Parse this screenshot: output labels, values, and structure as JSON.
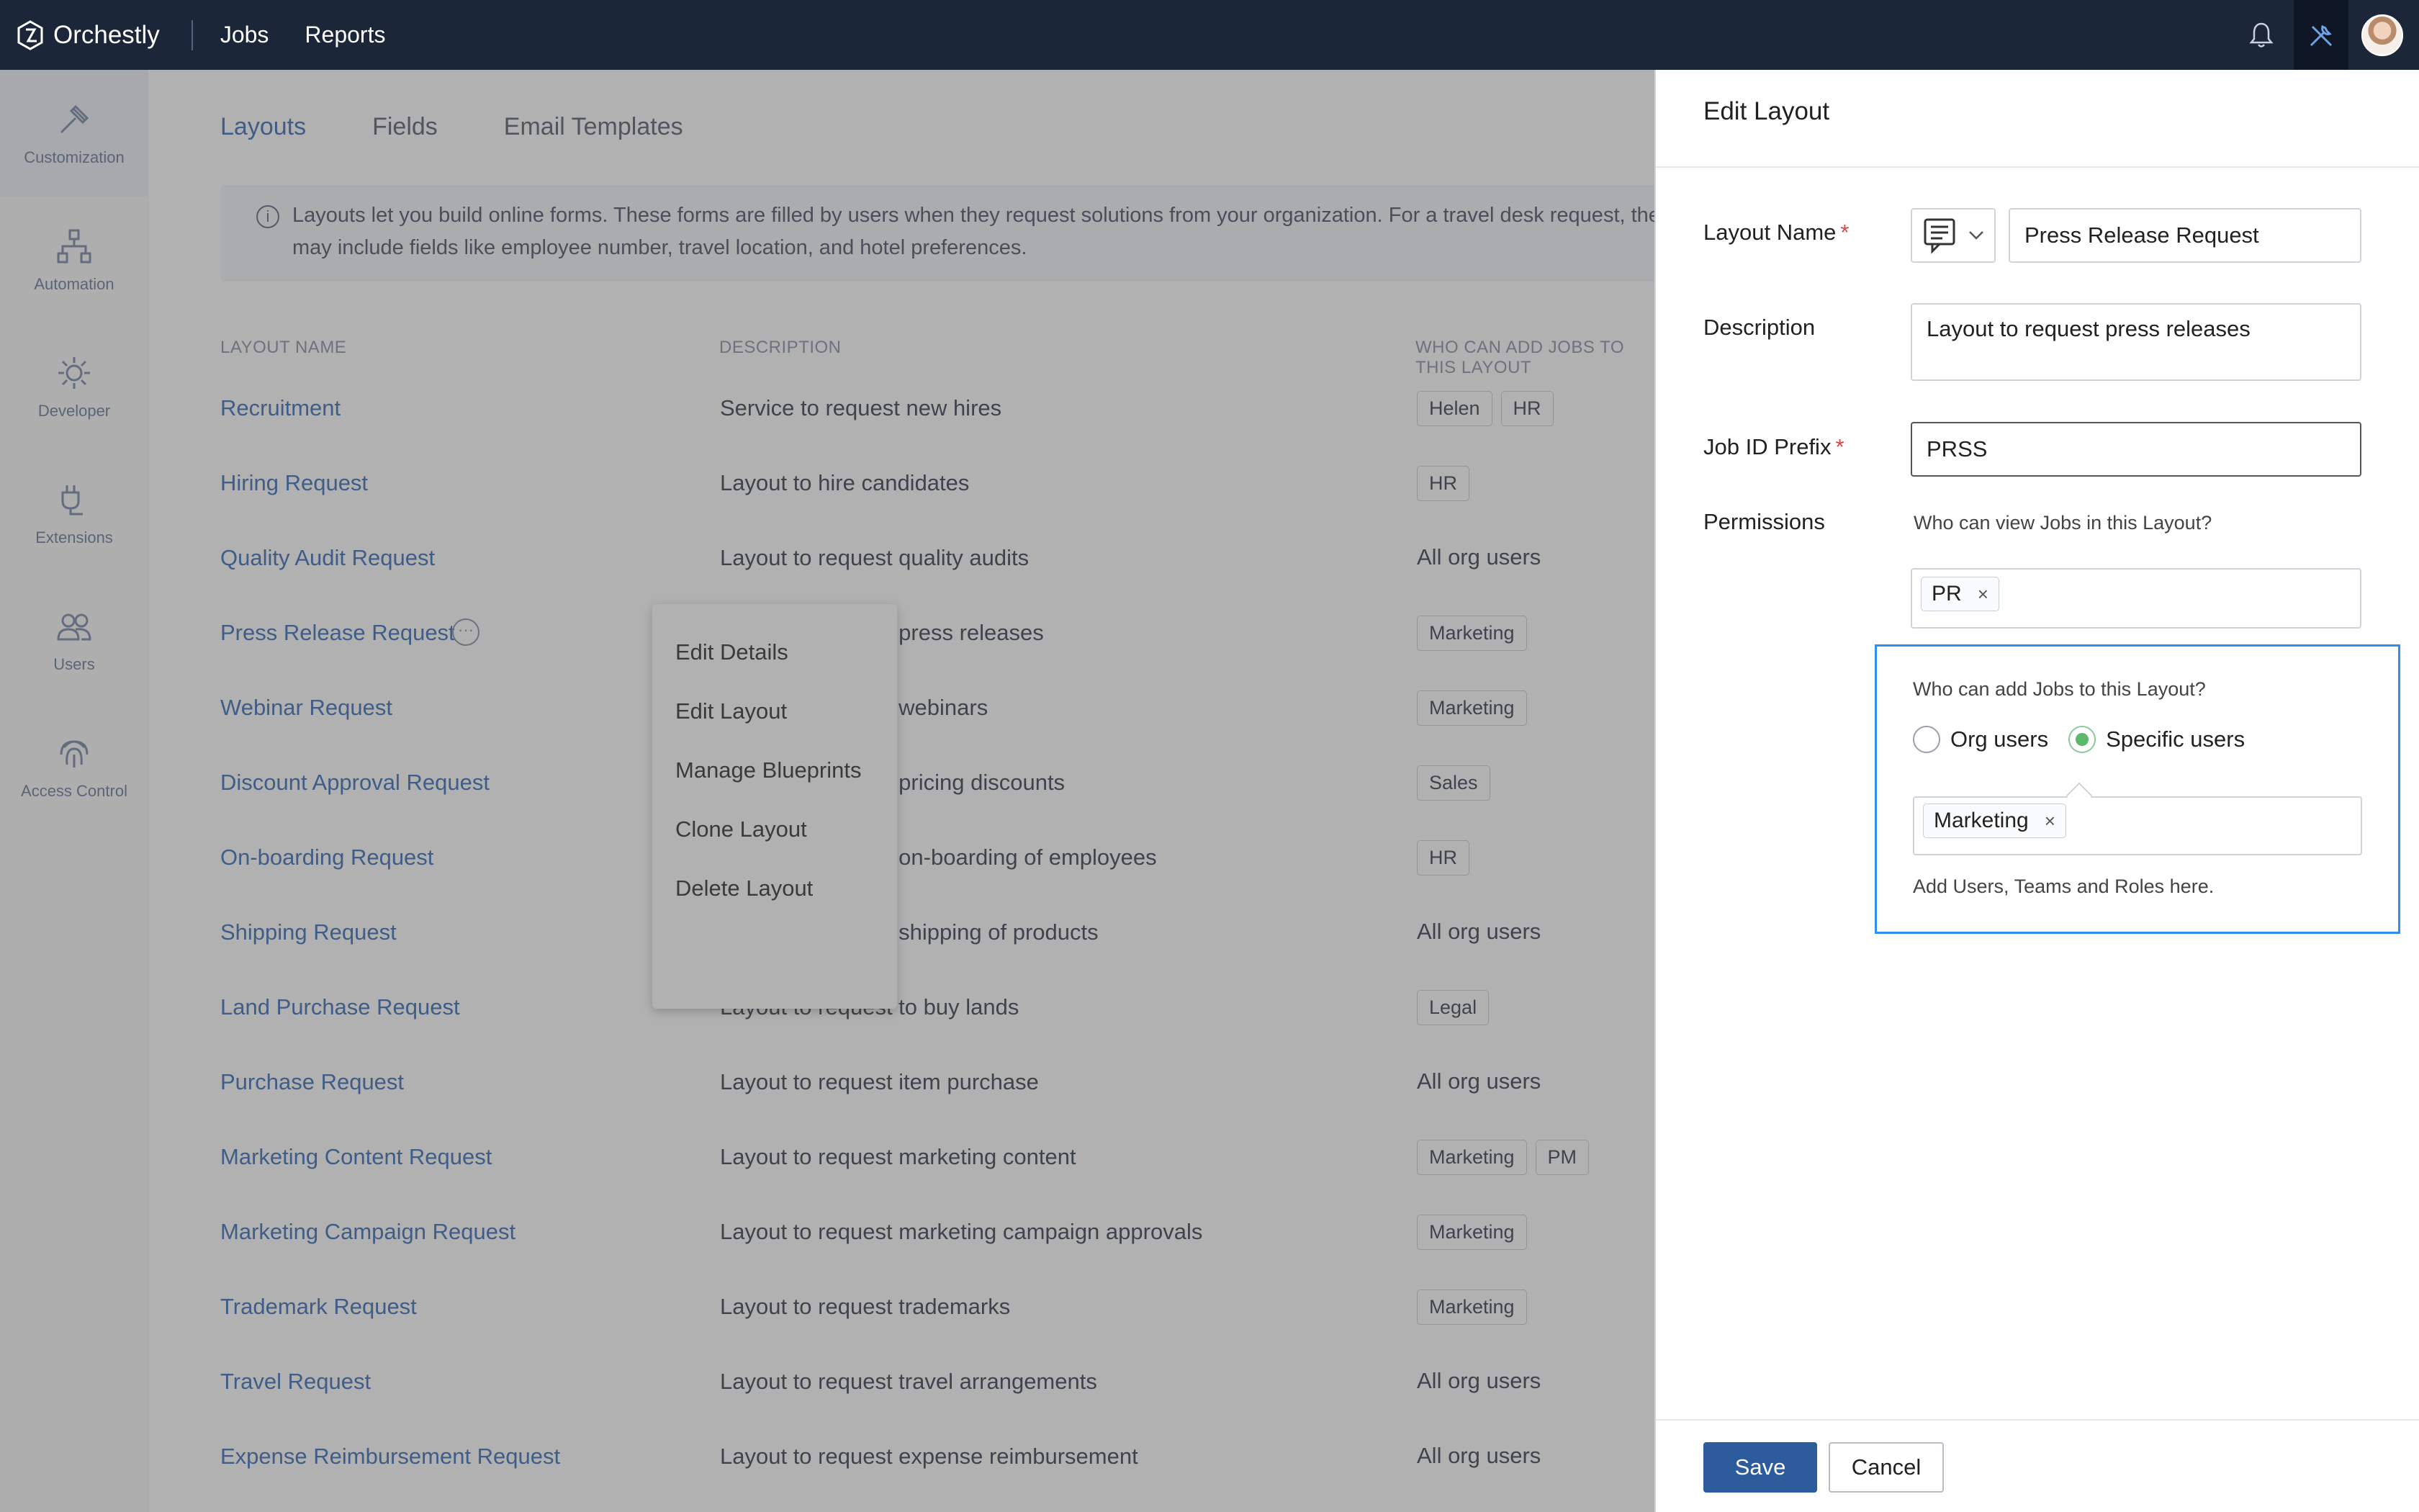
{
  "topbar": {
    "brand": "Orchestly",
    "nav": [
      "Jobs",
      "Reports"
    ]
  },
  "sidebar": {
    "items": [
      {
        "label": "Customization",
        "icon": "customization-icon"
      },
      {
        "label": "Automation",
        "icon": "automation-icon"
      },
      {
        "label": "Developer",
        "icon": "developer-icon"
      },
      {
        "label": "Extensions",
        "icon": "extensions-icon"
      },
      {
        "label": "Users",
        "icon": "users-icon"
      },
      {
        "label": "Access Control",
        "icon": "fingerprint-icon"
      }
    ]
  },
  "main": {
    "tabs": [
      "Layouts",
      "Fields",
      "Email Templates"
    ],
    "info": "Layouts let you build online forms. These forms are filled by users when they request solutions from your organization. For a travel desk request, the form may include fields like employee number, travel location, and hotel preferences.",
    "columns": [
      "LAYOUT NAME",
      "DESCRIPTION",
      "WHO CAN ADD JOBS TO THIS LAYOUT"
    ],
    "rows": [
      {
        "name": "Recruitment",
        "desc": "Service to request new hires",
        "who": [
          "Helen",
          "HR"
        ],
        "chips": true
      },
      {
        "name": "Hiring Request",
        "desc": "Layout to hire candidates",
        "who": [
          "HR"
        ],
        "chips": true
      },
      {
        "name": "Quality Audit Request",
        "desc": "Layout to request quality audits",
        "who": [
          "All org users"
        ],
        "chips": false
      },
      {
        "name": "Press Release Request",
        "desc": "Layout to request press releases",
        "who": [
          "Marketing"
        ],
        "chips": true
      },
      {
        "name": "Webinar Request",
        "desc": "Layout to request webinars",
        "who": [
          "Marketing"
        ],
        "chips": true
      },
      {
        "name": "Discount Approval Request",
        "desc": "Layout to request pricing discounts",
        "who": [
          "Sales"
        ],
        "chips": true
      },
      {
        "name": "On-boarding Request",
        "desc": "Layout to request on-boarding of employees",
        "who": [
          "HR"
        ],
        "chips": true
      },
      {
        "name": "Shipping Request",
        "desc": "Layout to request shipping of products",
        "who": [
          "All org users"
        ],
        "chips": false
      },
      {
        "name": "Land Purchase Request",
        "desc": "Layout to request to buy lands",
        "who": [
          "Legal"
        ],
        "chips": true
      },
      {
        "name": "Purchase Request",
        "desc": "Layout to request item purchase",
        "who": [
          "All org users"
        ],
        "chips": false
      },
      {
        "name": "Marketing Content Request",
        "desc": "Layout to request marketing content",
        "who": [
          "Marketing",
          "PM"
        ],
        "chips": true
      },
      {
        "name": "Marketing Campaign Request",
        "desc": "Layout to request marketing campaign approvals",
        "who": [
          "Marketing"
        ],
        "chips": true
      },
      {
        "name": "Trademark Request",
        "desc": "Layout to request trademarks",
        "who": [
          "Marketing"
        ],
        "chips": true
      },
      {
        "name": "Travel Request",
        "desc": "Layout to request travel arrangements",
        "who": [
          "All org users"
        ],
        "chips": false
      },
      {
        "name": "Expense Reimbursement Request",
        "desc": "Layout to request expense reimbursement",
        "who": [
          "All org users"
        ],
        "chips": false
      }
    ],
    "context_menu": [
      "Edit Details",
      "Edit Layout",
      "Manage Blueprints",
      "Clone Layout",
      "Delete Layout"
    ]
  },
  "panel": {
    "title": "Edit Layout",
    "layout_name_label": "Layout Name",
    "layout_name_value": "Press Release Request",
    "description_label": "Description",
    "description_value": "Layout to request press releases",
    "prefix_label": "Job ID Prefix",
    "prefix_value": "PRSS",
    "permissions_label": "Permissions",
    "view_question": "Who can view Jobs in this Layout?",
    "view_tags": [
      "PR"
    ],
    "add_question": "Who can add Jobs to this Layout?",
    "radio_org": "Org users",
    "radio_specific": "Specific users",
    "selected_radio": "Specific users",
    "add_tags": [
      "Marketing"
    ],
    "hint": "Add Users, Teams and Roles here.",
    "save": "Save",
    "cancel": "Cancel",
    "tag_remove": "×"
  },
  "colors": {
    "topbar": "#1b2638",
    "link": "#3d6fb8",
    "primary_button": "#2c5c9c",
    "focus_border": "#2f8ff0",
    "radio_selected": "#5cb86a"
  }
}
